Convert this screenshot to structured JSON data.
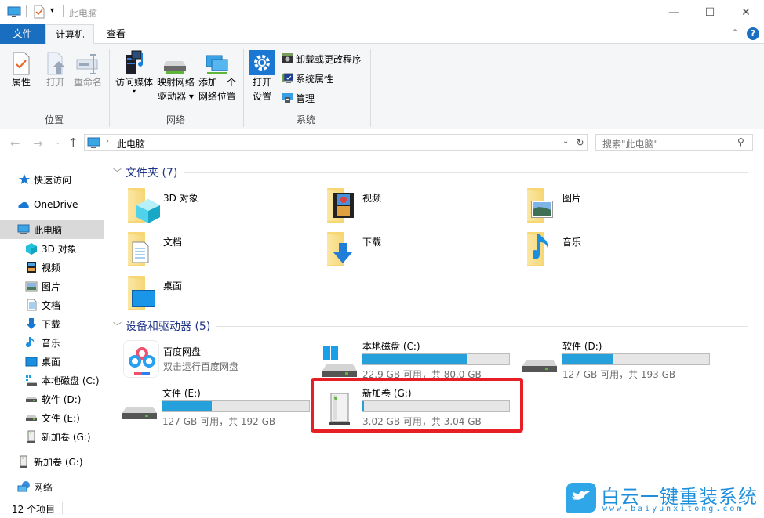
{
  "window": {
    "title": "此电脑",
    "controls": {
      "minimize": "—",
      "maximize": "☐",
      "close": "✕"
    }
  },
  "ribbon": {
    "tabs": [
      {
        "label": "文件",
        "active": false
      },
      {
        "label": "计算机",
        "active": true
      },
      {
        "label": "查看",
        "active": false
      }
    ],
    "groups": {
      "location": {
        "label": "位置",
        "buttons": [
          {
            "label": "属性",
            "enabled": true,
            "icon": "properties-icon"
          },
          {
            "label": "打开",
            "enabled": false,
            "icon": "open-icon"
          },
          {
            "label": "重命名",
            "enabled": false,
            "icon": "rename-icon"
          }
        ]
      },
      "network": {
        "label": "网络",
        "buttons": [
          {
            "label": "访问媒体",
            "icon": "media-icon"
          },
          {
            "label_line1": "映射网络",
            "label_line2": "驱动器",
            "icon": "map-drive-icon"
          },
          {
            "label_line1": "添加一个",
            "label_line2": "网络位置",
            "icon": "add-network-location-icon"
          }
        ]
      },
      "system": {
        "label": "系统",
        "open_settings_line1": "打开",
        "open_settings_line2": "设置",
        "small_buttons": [
          {
            "label": "卸载或更改程序",
            "icon": "uninstall-icon"
          },
          {
            "label": "系统属性",
            "icon": "system-properties-icon"
          },
          {
            "label": "管理",
            "icon": "manage-icon"
          }
        ]
      }
    }
  },
  "address": {
    "path": "此电脑",
    "search_placeholder": "搜索\"此电脑\""
  },
  "sidebar": {
    "items": [
      {
        "label": "快速访问",
        "icon": "star-icon",
        "level": 0
      },
      {
        "label": "OneDrive",
        "icon": "cloud-icon",
        "level": 0
      },
      {
        "label": "此电脑",
        "icon": "computer-icon",
        "level": 0,
        "selected": true
      },
      {
        "label": "3D 对象",
        "icon": "cube-icon",
        "level": 1
      },
      {
        "label": "视频",
        "icon": "video-icon",
        "level": 1
      },
      {
        "label": "图片",
        "icon": "picture-icon",
        "level": 1
      },
      {
        "label": "文档",
        "icon": "document-icon",
        "level": 1
      },
      {
        "label": "下载",
        "icon": "download-icon",
        "level": 1
      },
      {
        "label": "音乐",
        "icon": "music-icon",
        "level": 1
      },
      {
        "label": "桌面",
        "icon": "desktop-icon",
        "level": 1
      },
      {
        "label": "本地磁盘 (C:)",
        "icon": "windows-drive-icon",
        "level": 1
      },
      {
        "label": "软件 (D:)",
        "icon": "drive-icon",
        "level": 1
      },
      {
        "label": "文件 (E:)",
        "icon": "drive-icon",
        "level": 1
      },
      {
        "label": "新加卷 (G:)",
        "icon": "usb-drive-icon",
        "level": 1
      },
      {
        "label": "新加卷 (G:)",
        "icon": "usb-drive-icon",
        "level": 0
      },
      {
        "label": "网络",
        "icon": "network-icon",
        "level": 0
      }
    ]
  },
  "folders_section": {
    "title": "文件夹 (7)",
    "items": [
      {
        "label": "3D 对象",
        "overlay": "cube"
      },
      {
        "label": "视频",
        "overlay": "film"
      },
      {
        "label": "图片",
        "overlay": "picture"
      },
      {
        "label": "文档",
        "overlay": "document"
      },
      {
        "label": "下载",
        "overlay": "download"
      },
      {
        "label": "音乐",
        "overlay": "music"
      },
      {
        "label": "桌面",
        "overlay": "desktop"
      }
    ]
  },
  "devices_section": {
    "title": "设备和驱动器 (5)",
    "baidu": {
      "name": "百度网盘",
      "subtitle": "双击运行百度网盘"
    },
    "drives": [
      {
        "name": "本地磁盘 (C:)",
        "info": "22.9 GB 可用，共 80.0 GB",
        "used_fraction": 0.714,
        "icon": "windows-drive-icon"
      },
      {
        "name": "软件 (D:)",
        "info": "127 GB 可用，共 193 GB",
        "used_fraction": 0.342,
        "icon": "drive-icon"
      },
      {
        "name": "文件 (E:)",
        "info": "127 GB 可用，共 192 GB",
        "used_fraction": 0.339,
        "icon": "drive-icon"
      },
      {
        "name": "新加卷 (G:)",
        "info": "3.02 GB 可用，共 3.04 GB",
        "used_fraction": 0.007,
        "icon": "usb-drive-icon",
        "highlighted": true
      }
    ]
  },
  "status": {
    "count": "12 个项目"
  },
  "watermark": {
    "title": "白云一键重装系统",
    "url": "www.baiyunxitong.com"
  },
  "colors": {
    "accent": "#1a6ec0",
    "bar_fill": "#26a0da",
    "highlight": "#e81e25",
    "section_header": "#1e3287"
  }
}
